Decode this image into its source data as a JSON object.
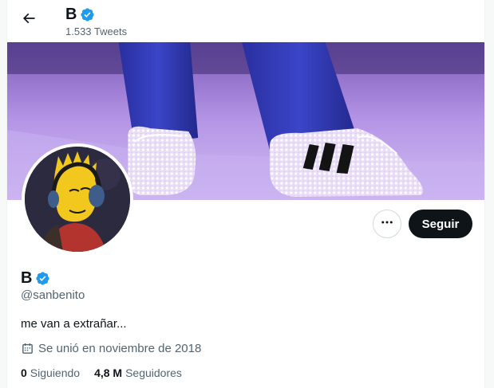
{
  "header": {
    "name": "B",
    "tweet_count": "1.533 Tweets"
  },
  "profile": {
    "name": "B",
    "handle": "@sanbenito",
    "bio": "me van a extrañar...",
    "joined": "Se unió en noviembre de 2018",
    "following_count": "0",
    "following_label": "Siguiendo",
    "followers_count": "4,8 M",
    "followers_label": "Seguidores"
  },
  "actions": {
    "follow_label": "Seguir"
  },
  "icons": {
    "back": "arrow-left-icon",
    "verified": "verified-badge-icon",
    "more": "more-dots-icon",
    "calendar": "calendar-icon"
  },
  "colors": {
    "verified_blue": "#1d9bf0",
    "follow_button": "#0f1419",
    "secondary_text": "#536471",
    "banner_tint": "#a98ad9"
  }
}
